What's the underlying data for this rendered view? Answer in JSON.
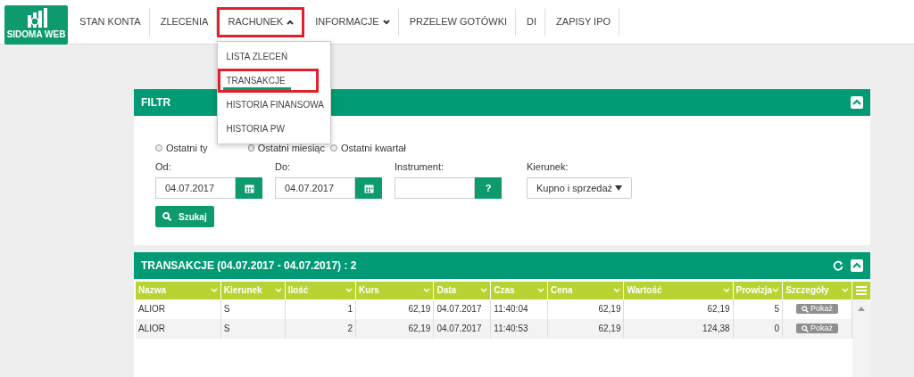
{
  "logo": {
    "text": "SIDOMA WEB"
  },
  "nav": [
    {
      "label": "STAN KONTA",
      "highlighted": false
    },
    {
      "label": "ZLECENIA",
      "highlighted": false
    },
    {
      "label": "RACHUNEK",
      "expanded": true,
      "highlighted": true
    },
    {
      "label": "INFORMACJE",
      "expanded": false,
      "highlighted": false
    },
    {
      "label": "PRZELEW GOTÓWKI",
      "highlighted": false
    },
    {
      "label": "DI",
      "highlighted": false
    },
    {
      "label": "ZAPISY IPO",
      "highlighted": false
    }
  ],
  "menu": [
    {
      "label": "LISTA ZLECEŃ",
      "selected": false,
      "highlighted": false
    },
    {
      "label": "TRANSAKCJE",
      "selected": true,
      "highlighted": true
    },
    {
      "label": "HISTORIA FINANSOWA",
      "selected": false,
      "highlighted": false
    },
    {
      "label": "HISTORIA PW",
      "selected": false,
      "highlighted": false
    }
  ],
  "filter": {
    "title": "FILTR",
    "periods": [
      {
        "label": "Ostatni ty",
        "selected": false
      },
      {
        "label": "Ostatni miesiąc",
        "selected": false
      },
      {
        "label": "Ostatni kwartał",
        "selected": false
      }
    ],
    "fields": [
      {
        "label": "Od:",
        "kind": "date",
        "value": "04.07.2017"
      },
      {
        "label": "Do:",
        "kind": "date",
        "value": "04.07.2017"
      },
      {
        "label": "Instrument:",
        "kind": "lookup",
        "button": "?"
      },
      {
        "label": "Kierunek:",
        "kind": "select",
        "value": "Kupno i sprzedaż"
      }
    ],
    "search_button": "Szukaj"
  },
  "transactions": {
    "title": "TRANSAKCJE (04.07.2017 - 04.07.2017) : 2",
    "columns": [
      {
        "label": "Nazwa"
      },
      {
        "label": "Kierunek"
      },
      {
        "label": "Ilość"
      },
      {
        "label": "Kurs"
      },
      {
        "label": "Data"
      },
      {
        "label": "Czas"
      },
      {
        "label": "Cena"
      },
      {
        "label": "Wartość"
      },
      {
        "label": "Prowizja"
      },
      {
        "label": "Szczegóły"
      }
    ],
    "rows": [
      {
        "cells": [
          "ALIOR",
          "S",
          "1",
          "62,19",
          "04.07.2017",
          "11:40:04",
          "62,19",
          "62,19",
          "5"
        ],
        "button": "Pokaż"
      },
      {
        "cells": [
          "ALIOR",
          "S",
          "2",
          "62,19",
          "04.07.2017",
          "11:40:53",
          "62,19",
          "124,38",
          "0"
        ],
        "button": "Pokaż"
      }
    ]
  }
}
